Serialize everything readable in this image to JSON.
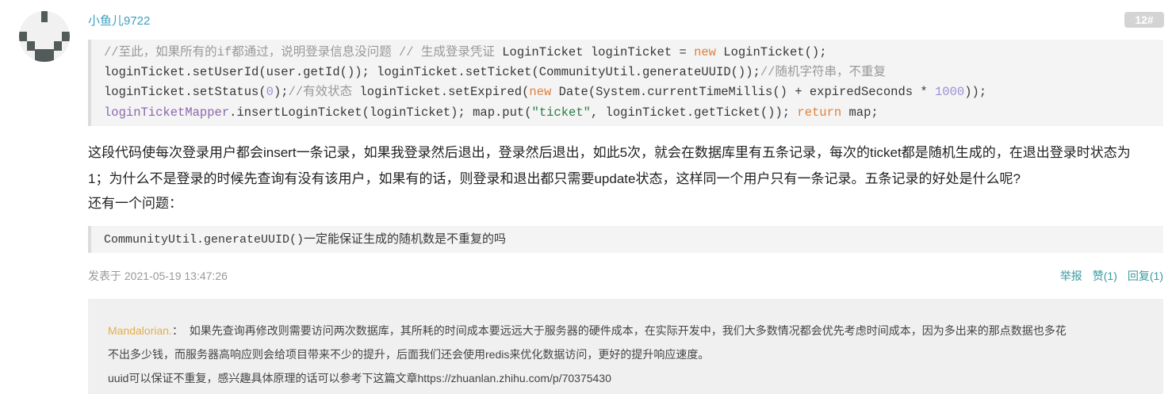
{
  "comment": {
    "username": "小鱼儿9722",
    "floor": "12#",
    "code_block": {
      "l1_cm": "//至此，如果所有的if都通过，说明登录信息没问题 // 生成登录凭证 ",
      "l1_a": "LoginTicket loginTicket = ",
      "l1_new": "new",
      "l1_b": " LoginTicket();",
      "l2_a": "loginTicket.setUserId(user.getId()); loginTicket.setTicket(CommunityUtil.generateUUID());",
      "l2_cm": "//随机字符串，不重复",
      "l3_a": "loginTicket.setStatus(",
      "l3_num": "0",
      "l3_b": ");",
      "l3_cm": "//有效状态 ",
      "l3_c": "loginTicket.setExpired(",
      "l3_new": "new",
      "l3_d": " Date(System.currentTimeMillis() + expiredSeconds * ",
      "l3_num2": "1000",
      "l3_e": "));",
      "l4_var": "loginTicketMapper",
      "l4_a": ".insertLoginTicket(loginTicket); map.put(",
      "l4_str": "\"ticket\"",
      "l4_b": ", loginTicket.getTicket()); ",
      "l4_ret": "return",
      "l4_c": " map;"
    },
    "paragraph_line1": "这段代码使每次登录用户都会insert一条记录，如果我登录然后退出，登录然后退出，如此5次，就会在数据库里有五条记录，每次的ticket都是随机生成的，在退出登录时状态为",
    "paragraph_line2": "1；为什么不是登录的时候先查询有没有该用户，如果有的话，则登录和退出都只需要update状态，这样同一个用户只有一条记录。五条记录的好处是什么呢?",
    "paragraph_line3": "还有一个问题：",
    "code_block2_code": "CommunityUtil.generateUUID()",
    "code_block2_text": "一定能保证生成的随机数是不重复的吗",
    "posted_at": "发表于 2021-05-19 13:47:26",
    "actions": {
      "report": "举报",
      "like": "赞(1)",
      "reply": "回复(1)"
    }
  },
  "reply": {
    "author": "Mandalorian.",
    "separator": "：",
    "line1": "如果先查询再修改则需要访问两次数据库，其所耗的时间成本要远远大于服务器的硬件成本，在实际开发中，我们大多数情况都会优先考虑时间成本，因为多出来的那点数据也多花",
    "line2": "不出多少钱，而服务器高响应则会给项目带来不少的提升，后面我们还会使用redis来优化数据访问，更好的提升响应速度。",
    "line3": "uuid可以保证不重复，感兴趣具体原理的话可以参考下这篇文章https://zhuanlan.zhihu.com/p/70375430"
  },
  "colors": {
    "username": "#3aa0bf",
    "action_links": "#3a9aa0",
    "reply_author": "#e2ae4a",
    "keyword": "#e0813c"
  }
}
